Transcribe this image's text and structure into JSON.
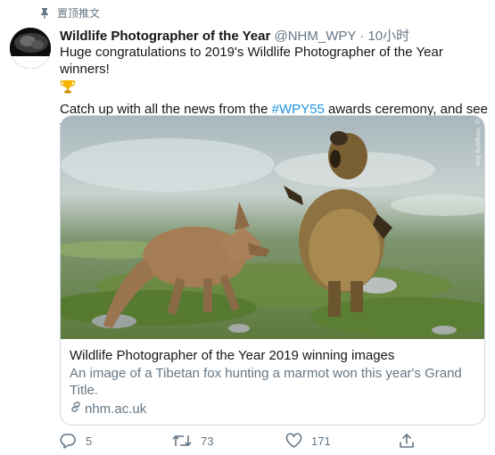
{
  "pinned_label": "置顶推文",
  "tweet": {
    "author_name": "Wildlife Photographer of the Year",
    "handle": "@NHM_WPY",
    "separator": "·",
    "time": "10小时",
    "line1": "Huge congratulations to 2019's Wildlife Photographer of the Year winners!",
    "line2_prefix": "Catch up with all the news from the ",
    "hashtag": "#WPY55",
    "line2_suffix": " awards ceremony, and see which images won over our judges:"
  },
  "card": {
    "image_credit": "© Yongqing Bao",
    "title": "Wildlife Photographer of the Year 2019 winning images",
    "description": "An image of a Tibetan fox hunting a marmot won this year's Grand Title.",
    "domain": "nhm.ac.uk"
  },
  "actions": {
    "replies": "5",
    "retweets": "73",
    "likes": "171"
  },
  "colors": {
    "text": "#14171a",
    "muted": "#657786",
    "link": "#1b95e0",
    "border": "#ccd6dd"
  },
  "icons": [
    "pin-icon",
    "trophy-icon",
    "link-icon",
    "reply-icon",
    "retweet-icon",
    "like-icon",
    "share-icon"
  ]
}
